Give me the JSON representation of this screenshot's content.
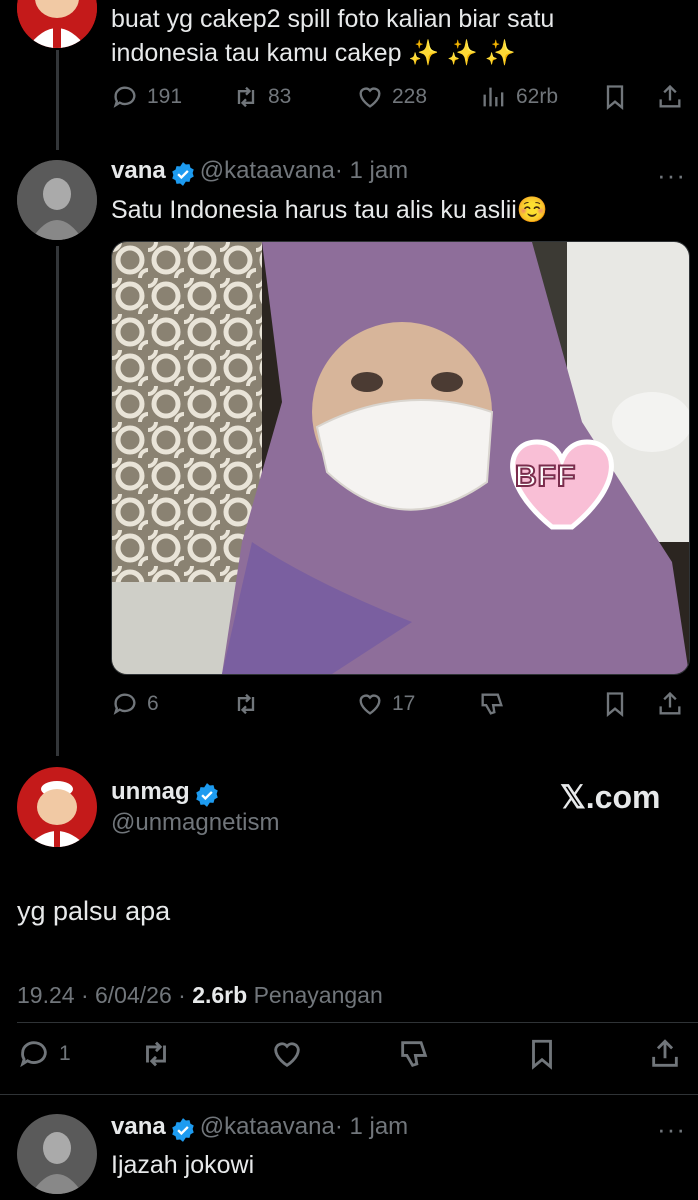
{
  "tweet0": {
    "text_line1": "buat yg cakep2 spill foto kalian biar satu",
    "text_line2": "indonesia tau kamu cakep",
    "emoji": "✨ ✨ ✨",
    "replies": "191",
    "reposts": "83",
    "likes": "228",
    "views": "62rb"
  },
  "tweet1": {
    "name": "vana",
    "handle": "@kataavana",
    "time": "· 1 jam",
    "text": "Satu Indonesia harus tau alis ku aslii",
    "emoji": "☺️",
    "sticker": "BFF",
    "replies": "6",
    "likes": "17"
  },
  "main": {
    "name": "unmag",
    "handle": "@unmagnetism",
    "watermark": "𝕏.com",
    "text": "yg palsu apa",
    "time": "19.24 · 6/04/26 ·",
    "views_count": "2.6rb",
    "views_label": "Penayangan",
    "replies": "1"
  },
  "tweet2": {
    "name": "vana",
    "handle": "@kataavana",
    "time": "· 1 jam",
    "text": "Ijazah jokowi"
  },
  "colors": {
    "background": "#000000",
    "text": "#e7e9ea",
    "muted": "#71767b",
    "verified": "#1d9bf0",
    "divider": "#2f3336"
  }
}
